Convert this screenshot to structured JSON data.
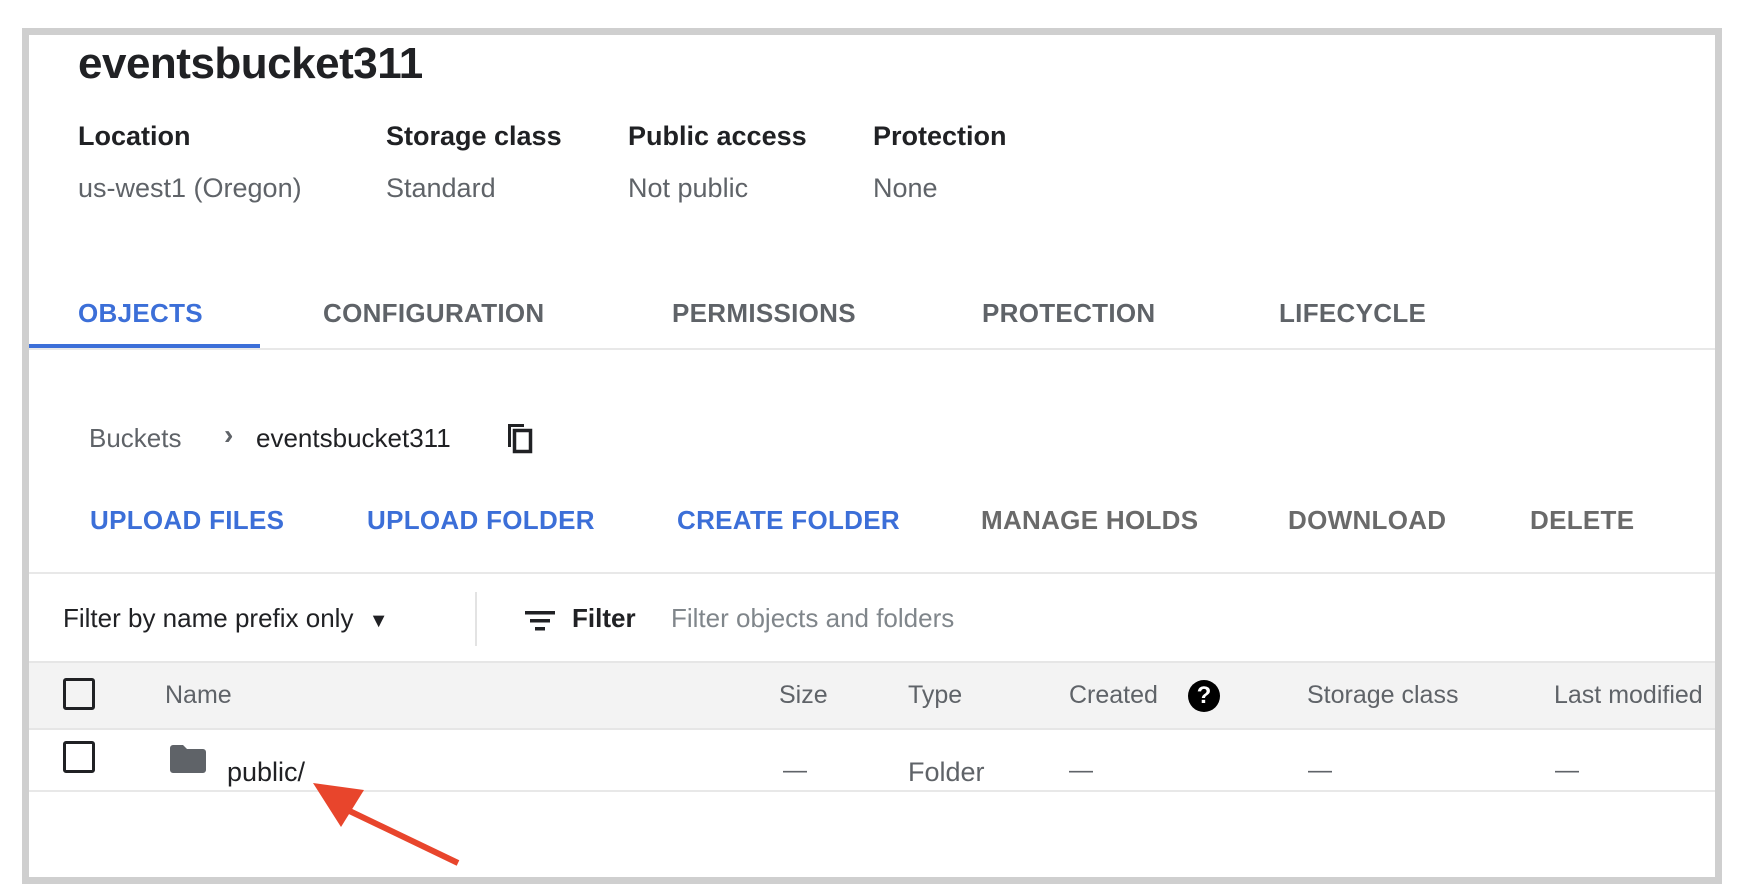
{
  "bucket": {
    "title": "eventsbucket311",
    "details": [
      {
        "label": "Location",
        "value": "us-west1 (Oregon)"
      },
      {
        "label": "Storage class",
        "value": "Standard"
      },
      {
        "label": "Public access",
        "value": "Not public"
      },
      {
        "label": "Protection",
        "value": "None"
      }
    ]
  },
  "tabs": [
    "OBJECTS",
    "CONFIGURATION",
    "PERMISSIONS",
    "PROTECTION",
    "LIFECYCLE"
  ],
  "breadcrumb": {
    "root": "Buckets",
    "current": "eventsbucket311"
  },
  "actions": [
    "UPLOAD FILES",
    "UPLOAD FOLDER",
    "CREATE FOLDER",
    "MANAGE HOLDS",
    "DOWNLOAD",
    "DELETE"
  ],
  "filter": {
    "mode": "Filter by name prefix only",
    "label": "Filter",
    "placeholder": "Filter objects and folders"
  },
  "table": {
    "columns": [
      "Name",
      "Size",
      "Type",
      "Created",
      "Storage class",
      "Last modified"
    ],
    "rows": [
      {
        "name": "public/",
        "size": "—",
        "type": "Folder",
        "created": "—",
        "storage_class": "—",
        "last_modified": "—"
      }
    ]
  },
  "colors": {
    "accent": "#3c6fd8",
    "annotation": "#e8452c"
  }
}
